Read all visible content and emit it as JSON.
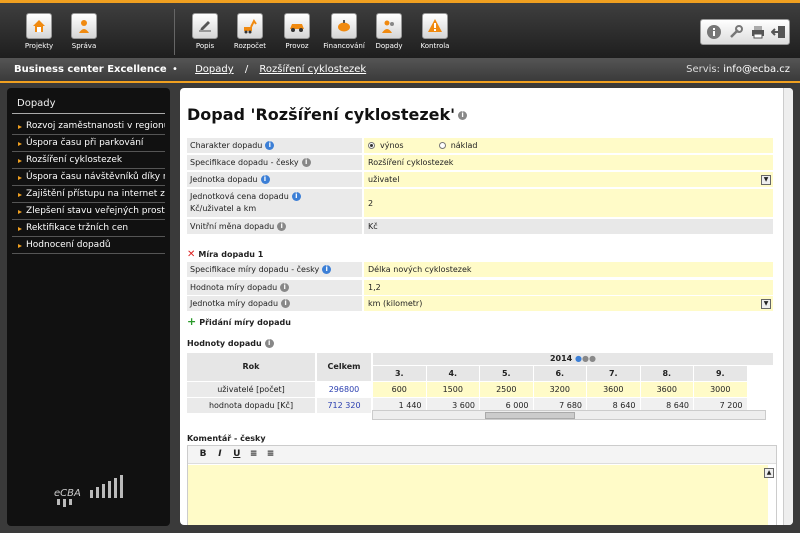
{
  "toolbar": {
    "left": [
      {
        "label": "Projekty",
        "icon": "home-icon"
      },
      {
        "label": "Správa",
        "icon": "person-icon"
      }
    ],
    "center": [
      {
        "label": "Popis",
        "icon": "pencil-icon"
      },
      {
        "label": "Rozpočet",
        "icon": "excavator-icon"
      },
      {
        "label": "Provoz",
        "icon": "car-icon"
      },
      {
        "label": "Financování",
        "icon": "piggy-bank-icon"
      },
      {
        "label": "Dopady",
        "icon": "people-icon"
      },
      {
        "label": "Kontrola",
        "icon": "warning-icon"
      }
    ],
    "right": [
      "info-icon",
      "wrench-icon",
      "print-icon",
      "logout-icon"
    ]
  },
  "subbar": {
    "app_title": "Business center Excellence",
    "breadcrumb": [
      "Dopady",
      "Rozšíření cyklostezek"
    ],
    "servis_label": "Servis:",
    "servis_email": "info@ecba.cz"
  },
  "sidebar": {
    "title": "Dopady",
    "items": [
      "Rozvoj zaměstnanosti v regionu",
      "Úspora času při parkování",
      "Rozšíření cyklostezek",
      "Úspora času návštěvníků díky nov",
      "Zajištění přístupu na internet zda",
      "Zlepšení stavu veřejných prostrar",
      "Rektifikace tržních cen",
      "Hodnocení dopadů"
    ],
    "logo_text": "eCBA"
  },
  "main": {
    "title": "Dopad 'Rozšíření cyklostezek'",
    "fields": {
      "charakter_label": "Charakter dopadu",
      "charakter_options": [
        "výnos",
        "náklad"
      ],
      "charakter_selected": "výnos",
      "spec_label": "Specifikace dopadu - česky",
      "spec_value": "Rozšíření cyklostezek",
      "jednotka_label": "Jednotka dopadu",
      "jednotka_value": "uživatel",
      "cena_label_1": "Jednotková cena dopadu",
      "cena_label_2": "Kč/uživatel a km",
      "cena_value": "2",
      "mena_label": "Vnitřní měna dopadu",
      "mena_value": "Kč"
    },
    "mira": {
      "title": "Míra dopadu 1",
      "spec_label": "Specifikace míry dopadu - česky",
      "spec_value": "Délka nových cyklostezek",
      "hodnota_label": "Hodnota míry dopadu",
      "hodnota_value": "1,2",
      "jednotka_label": "Jednotka míry dopadu",
      "jednotka_value": "km (kilometr)",
      "add_label": "Přidání míry dopadu"
    },
    "hodnoty": {
      "title": "Hodnoty dopadu",
      "col_rok": "Rok",
      "col_celkem": "Celkem",
      "year": "2014",
      "periods": [
        "3.",
        "4.",
        "5.",
        "6.",
        "7.",
        "8.",
        "9."
      ],
      "rows": [
        {
          "label": "uživatelé [počet]",
          "celkem": "296800",
          "values": [
            "600",
            "1500",
            "2500",
            "3200",
            "3600",
            "3600",
            "3000"
          ]
        },
        {
          "label": "hodnota dopadu [Kč]",
          "celkem": "712 320",
          "values": [
            "1 440",
            "3 600",
            "6 000",
            "7 680",
            "8 640",
            "8 640",
            "7 200"
          ]
        }
      ]
    },
    "komentar": {
      "title": "Komentář - česky",
      "tools": [
        "B",
        "I",
        "U"
      ]
    }
  }
}
